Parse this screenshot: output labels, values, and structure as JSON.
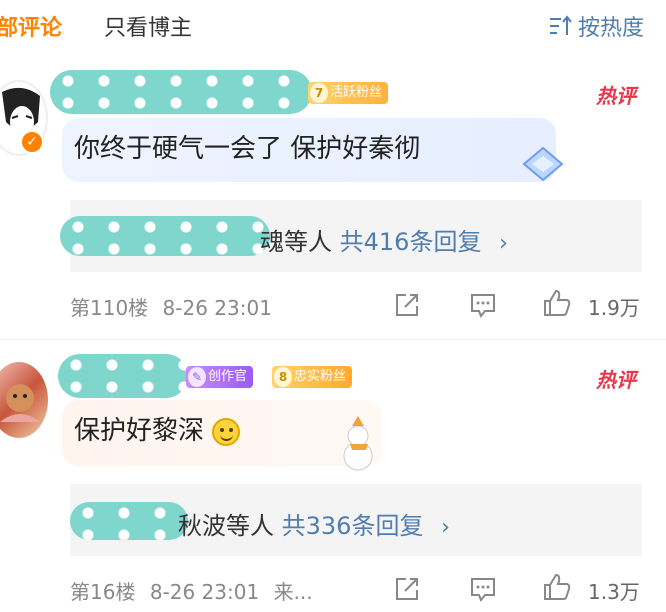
{
  "tabs": {
    "all_comments": "部评论",
    "blogger_only": "只看博主",
    "sort_label": "按热度"
  },
  "comments": [
    {
      "badge_level": "7",
      "badge_label": "活跃粉丝",
      "hot_label": "热评",
      "text": "你终于硬气一会了 保护好秦彻",
      "reply_suffix": "魂等人",
      "reply_count": "共416条回复",
      "floor": "第110楼",
      "time": "8-26 23:01",
      "likes": "1.9万"
    },
    {
      "creator_label": "创作官",
      "badge_level": "8",
      "badge_label": "忠实粉丝",
      "hot_label": "热评",
      "text": "保护好黎深",
      "reply_suffix": "秋波等人",
      "reply_count": "共336条回复",
      "floor": "第16楼",
      "time": "8-26 23:01",
      "source": "来...",
      "likes": "1.3万"
    }
  ],
  "colors": {
    "accent": "#ff8200",
    "link": "#507daf",
    "hot": "#e8364a",
    "blob": "#7fd6cc"
  }
}
